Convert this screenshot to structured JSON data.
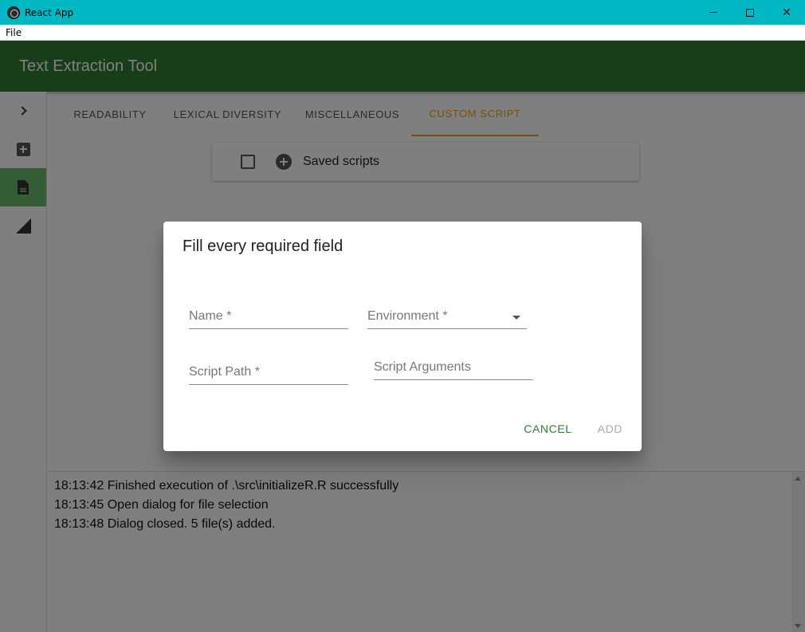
{
  "window": {
    "title": "React App",
    "icon": "electron-icon"
  },
  "menubar": {
    "items": [
      "File"
    ]
  },
  "appbar": {
    "title": "Text Extraction Tool"
  },
  "sidebar": {
    "items": [
      "chevron-right-icon",
      "add-box-icon",
      "file-icon",
      "signal-icon"
    ],
    "active_index": 2
  },
  "tabs": {
    "items": [
      "Readability",
      "Lexical Diversity",
      "Miscellaneous",
      "Custom Script"
    ],
    "active_index": 3
  },
  "scripts_card": {
    "label": "Saved scripts"
  },
  "log": {
    "lines": [
      "18:13:42 Finished execution of .\\src\\initializeR.R successfully",
      "18:13:45 Open dialog for file selection",
      "18:13:48 Dialog closed. 5 file(s) added."
    ]
  },
  "dialog": {
    "title": "Fill every required field",
    "fields": {
      "name": "Name *",
      "environment": "Environment *",
      "script_path": "Script Path *",
      "script_arguments": "Script Arguments"
    },
    "cancel_label": "Cancel",
    "add_label": "Add"
  },
  "colors": {
    "appbar": "#2e7d32",
    "accent": "#f39c12",
    "titlebar": "#00b7c3"
  }
}
